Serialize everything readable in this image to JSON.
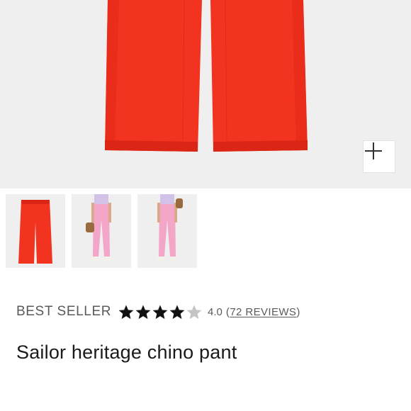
{
  "product": {
    "badge": "BEST SELLER",
    "rating": 4,
    "rating_text": "4.0",
    "reviews_open": "(",
    "reviews_label": "72 REVIEWS",
    "reviews_close": ")",
    "title": "Sailor heritage chino pant"
  },
  "gallery": {
    "zoom_icon": "plus-icon",
    "main_color": "#f2331f",
    "thumbnails": [
      {
        "name": "thumb-red-flatlay",
        "selected": true,
        "color": "#f2331f"
      },
      {
        "name": "thumb-pink-front",
        "selected": false,
        "color": "#f4a6c8"
      },
      {
        "name": "thumb-pink-back",
        "selected": false,
        "color": "#f4a6c8"
      }
    ]
  },
  "colors": {
    "star_filled": "#111111",
    "star_empty": "#c4c4c4",
    "text_muted": "#5a5a5a"
  }
}
